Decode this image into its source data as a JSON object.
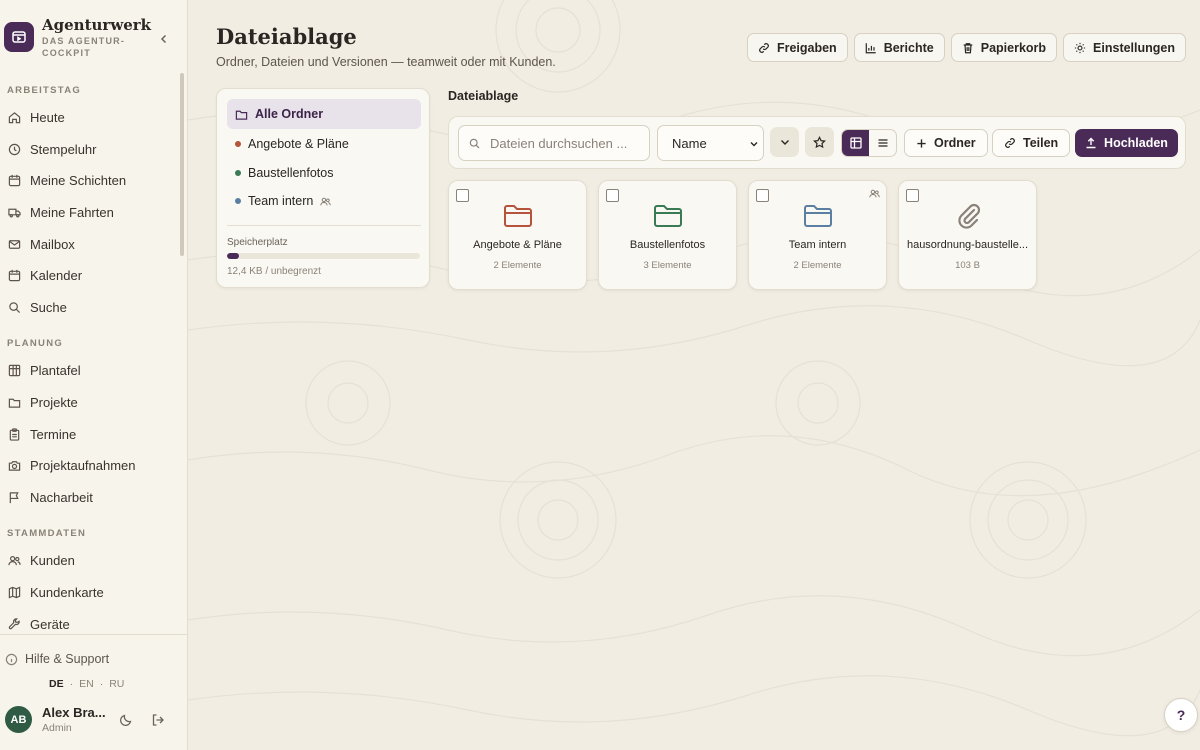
{
  "brand": {
    "name": "Agenturwerk",
    "subtitle": "DAS AGENTUR-COCKPIT"
  },
  "sidebar": {
    "sections": [
      {
        "title": "ARBEITSTAG",
        "items": [
          {
            "label": "Heute",
            "icon": "home-icon"
          },
          {
            "label": "Stempeluhr",
            "icon": "clock-icon"
          },
          {
            "label": "Meine Schichten",
            "icon": "calendar-icon"
          },
          {
            "label": "Meine Fahrten",
            "icon": "truck-icon"
          },
          {
            "label": "Mailbox",
            "icon": "mail-icon"
          },
          {
            "label": "Kalender",
            "icon": "calendar-icon"
          },
          {
            "label": "Suche",
            "icon": "search-icon"
          }
        ]
      },
      {
        "title": "PLANUNG",
        "items": [
          {
            "label": "Plantafel",
            "icon": "board-icon"
          },
          {
            "label": "Projekte",
            "icon": "folder-icon"
          },
          {
            "label": "Termine",
            "icon": "clipboard-icon"
          },
          {
            "label": "Projektaufnahmen",
            "icon": "camera-icon"
          },
          {
            "label": "Nacharbeit",
            "icon": "flag-icon"
          }
        ]
      },
      {
        "title": "STAMMDATEN",
        "items": [
          {
            "label": "Kunden",
            "icon": "users-icon"
          },
          {
            "label": "Kundenkarte",
            "icon": "map-icon"
          },
          {
            "label": "Geräte",
            "icon": "wrench-icon"
          }
        ]
      }
    ],
    "help_label": "Hilfe & Support",
    "languages": [
      "DE",
      "EN",
      "RU"
    ],
    "active_language": "DE",
    "user": {
      "initials": "AB",
      "name": "Alex Bra...",
      "role": "Admin"
    }
  },
  "header": {
    "title": "Dateiablage",
    "subtitle": "Ordner, Dateien und Versionen — teamweit oder mit Kunden.",
    "actions": [
      {
        "label": "Freigaben",
        "icon": "link-icon"
      },
      {
        "label": "Berichte",
        "icon": "bar-chart-icon"
      },
      {
        "label": "Papierkorb",
        "icon": "trash-icon"
      },
      {
        "label": "Einstellungen",
        "icon": "sun-icon"
      }
    ]
  },
  "folder_panel": {
    "items": [
      {
        "label": "Alle Ordner",
        "active": true
      },
      {
        "label": "Angebote & Pläne",
        "color": "#b5533c"
      },
      {
        "label": "Baustellenfotos",
        "color": "#3a7a55"
      },
      {
        "label": "Team intern",
        "color": "#5a7fa0",
        "shared": true
      }
    ],
    "storage_label": "Speicherplatz",
    "storage_text": "12,4 KB / unbegrenzt",
    "storage_fill_percent": 6
  },
  "main": {
    "title": "Dateiablage",
    "search_placeholder": "Dateien durchsuchen ...",
    "sort_value": "Name",
    "btn_folder": "Ordner",
    "btn_share": "Teilen",
    "btn_upload": "Hochladen",
    "items": [
      {
        "name": "Angebote & Pläne",
        "meta": "2 Elemente",
        "type": "folder",
        "color": "#b5533c"
      },
      {
        "name": "Baustellenfotos",
        "meta": "3 Elemente",
        "type": "folder",
        "color": "#3a7a55"
      },
      {
        "name": "Team intern",
        "meta": "2 Elemente",
        "type": "folder",
        "color": "#5a7fa0",
        "shared": true
      },
      {
        "name": "hausordnung-baustelle...",
        "meta": "103 B",
        "type": "file",
        "color": "#8a8278"
      }
    ]
  },
  "help_fab": "?"
}
